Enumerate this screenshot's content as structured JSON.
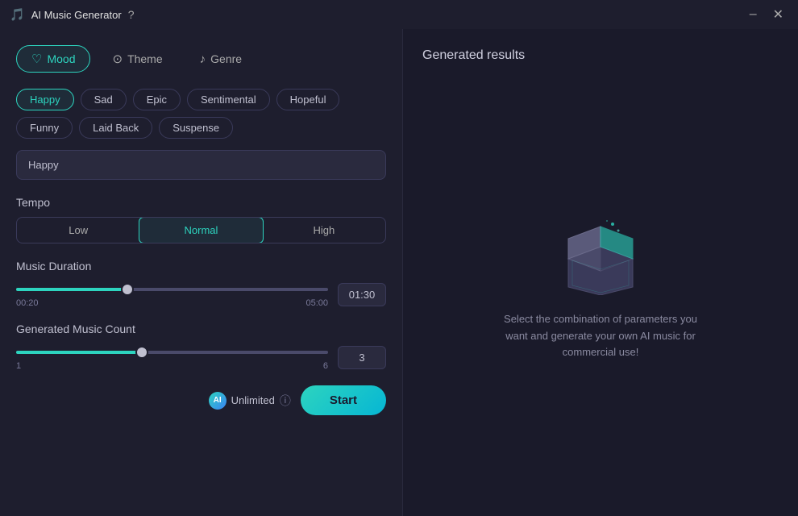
{
  "titleBar": {
    "title": "AI Music Generator",
    "helpIcon": "?",
    "minimizeLabel": "–",
    "closeLabel": "✕"
  },
  "tabs": [
    {
      "id": "mood",
      "label": "Mood",
      "icon": "♡",
      "active": true
    },
    {
      "id": "theme",
      "label": "Theme",
      "icon": "⊙",
      "active": false
    },
    {
      "id": "genre",
      "label": "Genre",
      "icon": "♪",
      "active": false
    }
  ],
  "moodTags": [
    {
      "label": "Happy",
      "selected": true
    },
    {
      "label": "Sad",
      "selected": false
    },
    {
      "label": "Epic",
      "selected": false
    },
    {
      "label": "Sentimental",
      "selected": false
    },
    {
      "label": "Hopeful",
      "selected": false
    },
    {
      "label": "Funny",
      "selected": false
    },
    {
      "label": "Laid Back",
      "selected": false
    },
    {
      "label": "Suspense",
      "selected": false
    }
  ],
  "selectedMood": "Happy",
  "tempo": {
    "label": "Tempo",
    "options": [
      {
        "label": "Low",
        "active": false
      },
      {
        "label": "Normal",
        "active": true
      },
      {
        "label": "High",
        "active": false
      }
    ]
  },
  "musicDuration": {
    "label": "Music Duration",
    "min": "00:20",
    "max": "05:00",
    "value": "01:30",
    "sliderPercent": 35
  },
  "generatedMusicCount": {
    "label": "Generated Music Count",
    "min": "1",
    "max": "6",
    "value": "3",
    "sliderPercent": 40
  },
  "unlimited": {
    "label": "Unlimited",
    "iconText": "AI"
  },
  "startButton": "Start",
  "rightPanel": {
    "title": "Generated results",
    "placeholderText": "Select the combination of parameters you want and generate your own AI music for commercial use!"
  }
}
